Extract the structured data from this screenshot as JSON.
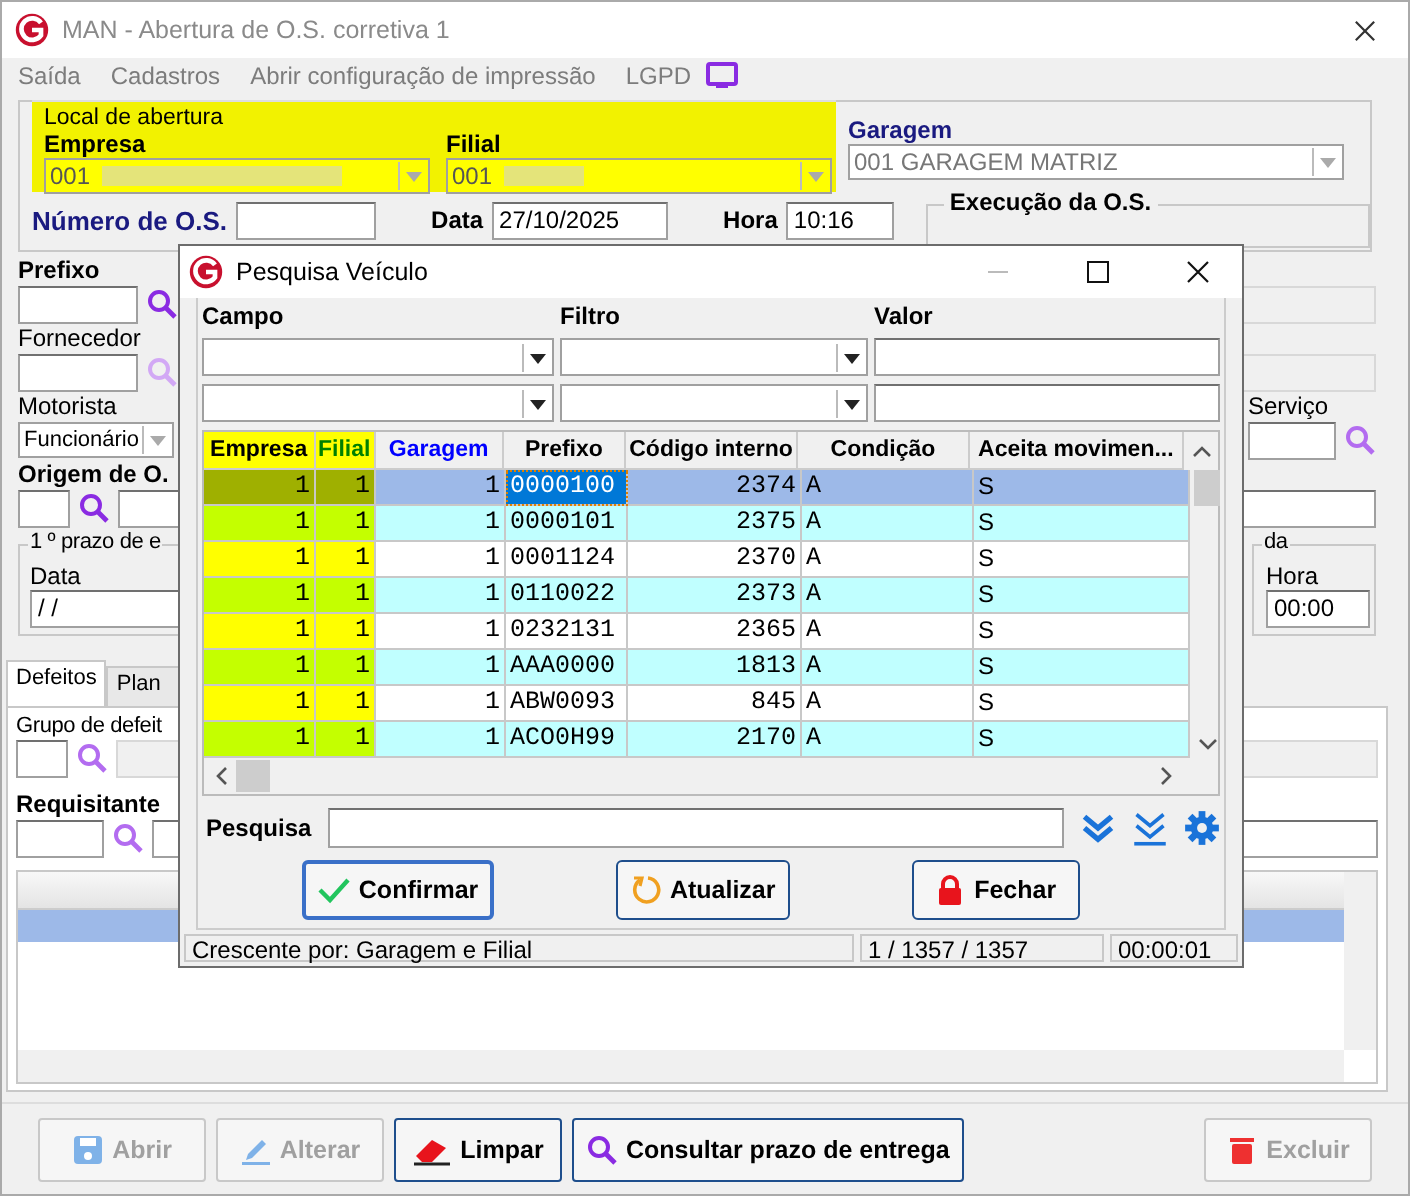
{
  "window": {
    "title": "MAN - Abertura de O.S. corretiva 1"
  },
  "menu": [
    "Saída",
    "Cadastros",
    "Abrir configuração de impressão",
    "LGPD"
  ],
  "local_de_abertura": {
    "title": "Local de abertura",
    "empresa": {
      "label": "Empresa",
      "value": "001"
    },
    "filial": {
      "label": "Filial",
      "value": "001"
    }
  },
  "garagem": {
    "label": "Garagem",
    "value": "001 GARAGEM MATRIZ"
  },
  "numero_os": {
    "label": "Número de O.S."
  },
  "data": {
    "label": "Data",
    "value": "27/10/2025"
  },
  "hora": {
    "label": "Hora",
    "value": "10:16"
  },
  "execucao": {
    "title": "Execução da O.S."
  },
  "left": {
    "prefixo": "Prefixo",
    "fornecedor": "Fornecedor",
    "motorista": "Motorista",
    "motorista_tipo": "Funcionário",
    "origem": "Origem de O.",
    "prazo_group": "1 º prazo de e",
    "prazo_data": {
      "label": "Data",
      "value": "/ /"
    }
  },
  "right": {
    "servico": "Serviço",
    "prazo_group": "da",
    "hora": {
      "label": "Hora",
      "value": "00:00"
    }
  },
  "tabs": [
    {
      "label": "Defeitos",
      "selected": true
    },
    {
      "label": "Plan",
      "selected": false
    }
  ],
  "defeitos": {
    "grupo": "Grupo de defeit",
    "requisitante": "Requisitante"
  },
  "buttons": [
    {
      "label": "Abrir",
      "kind": "save",
      "disabled": true
    },
    {
      "label": "Alterar",
      "kind": "edit",
      "disabled": true
    },
    {
      "label": "Limpar",
      "kind": "eraser",
      "disabled": false
    },
    {
      "label": "Consultar prazo de entrega",
      "kind": "search",
      "disabled": false
    },
    {
      "label": "Excluir",
      "kind": "delete",
      "disabled": true
    }
  ],
  "dialog": {
    "title": "Pesquisa Veículo",
    "filter_labels": [
      "Campo",
      "Filtro",
      "Valor"
    ],
    "columns": [
      {
        "label": "Empresa",
        "kind": "company",
        "highlighted": true
      },
      {
        "label": "Filial",
        "kind": "branch",
        "highlighted": true
      },
      {
        "label": "Garagem",
        "kind": "garage",
        "highlighted": false
      },
      {
        "label": "Prefixo",
        "kind": "plain",
        "highlighted": false
      },
      {
        "label": "Código interno",
        "kind": "plain",
        "highlighted": false
      },
      {
        "label": "Condição",
        "kind": "plain",
        "highlighted": false
      },
      {
        "label": "Aceita movimen...",
        "kind": "plain",
        "highlighted": false
      }
    ],
    "rows": [
      {
        "selected": true,
        "cells": [
          "1",
          "1",
          "1",
          "0000100",
          "2374",
          "A",
          "S"
        ]
      },
      {
        "selected": false,
        "cells": [
          "1",
          "1",
          "1",
          "0000101",
          "2375",
          "A",
          "S"
        ]
      },
      {
        "selected": false,
        "cells": [
          "1",
          "1",
          "1",
          "0001124",
          "2370",
          "A",
          "S"
        ]
      },
      {
        "selected": false,
        "cells": [
          "1",
          "1",
          "1",
          "0110022",
          "2373",
          "A",
          "S"
        ]
      },
      {
        "selected": false,
        "cells": [
          "1",
          "1",
          "1",
          "0232131",
          "2365",
          "A",
          "S"
        ]
      },
      {
        "selected": false,
        "cells": [
          "1",
          "1",
          "1",
          "AAA0000",
          "1813",
          "A",
          "S"
        ]
      },
      {
        "selected": false,
        "cells": [
          "1",
          "1",
          "1",
          "ABW0093",
          "845",
          "A",
          "S"
        ]
      },
      {
        "selected": false,
        "cells": [
          "1",
          "1",
          "1",
          "ACO0H99",
          "2170",
          "A",
          "S"
        ]
      }
    ],
    "search_label": "Pesquisa",
    "buttons": [
      {
        "label": "Confirmar",
        "kind": "confirm",
        "focused": true
      },
      {
        "label": "Atualizar",
        "kind": "refresh",
        "focused": false
      },
      {
        "label": "Fechar",
        "kind": "close",
        "focused": false
      }
    ],
    "status": [
      "Crescente por: Garagem e Filial",
      "1 / 1357 / 1357",
      "00:00:01"
    ]
  }
}
